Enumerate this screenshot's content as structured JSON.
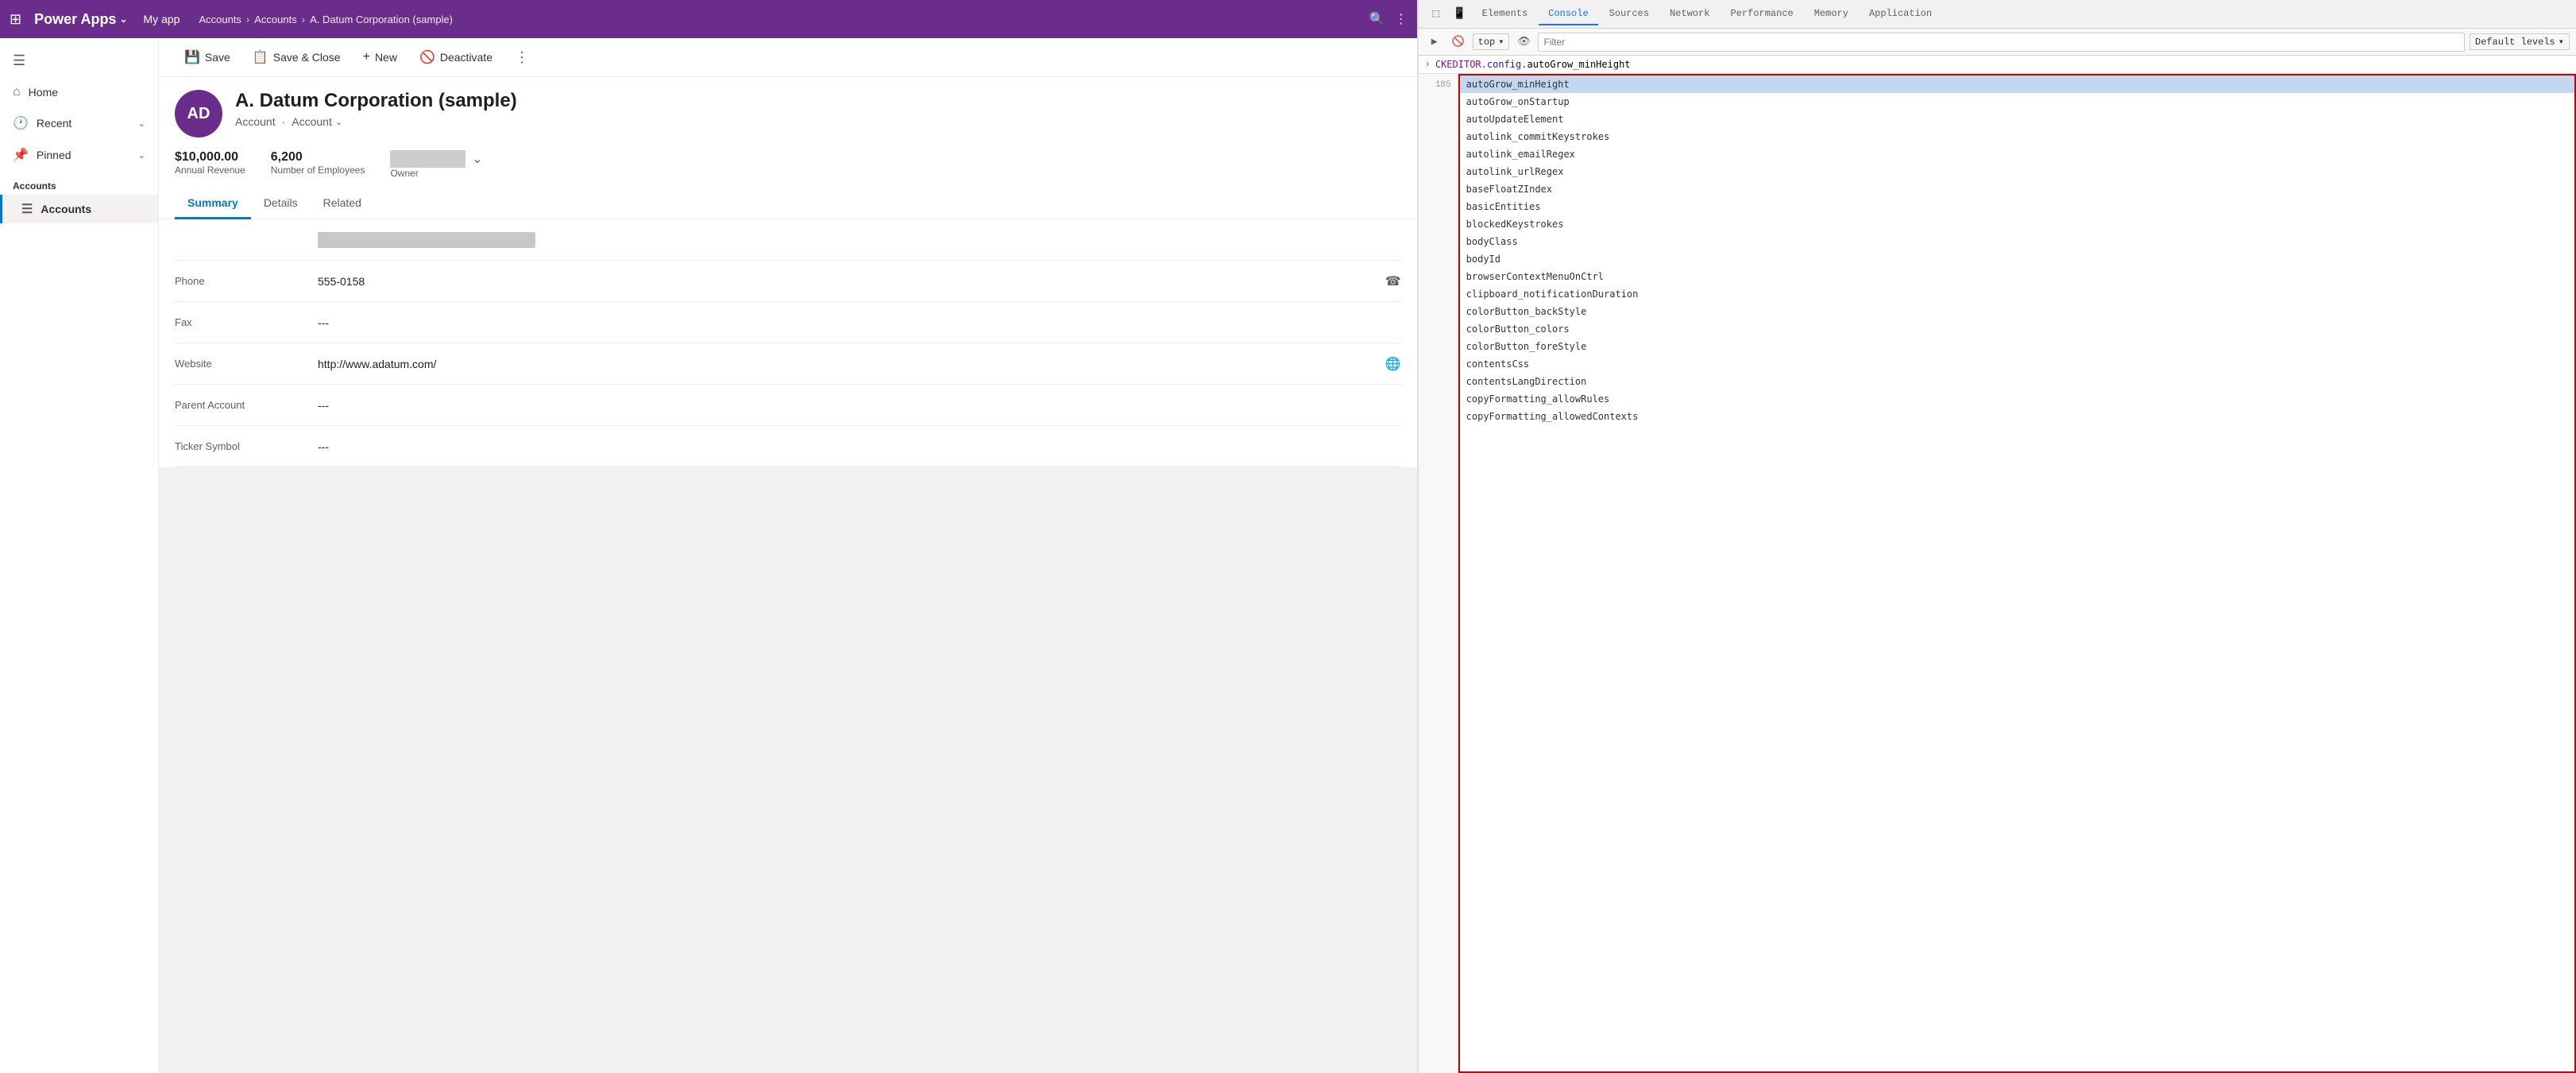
{
  "topNav": {
    "waffleLabel": "⊞",
    "appName": "Power Apps",
    "appChevron": "⌄",
    "myApp": "My app",
    "breadcrumb": [
      "Accounts",
      "Accounts",
      "A. Datum Corporation (sample)"
    ],
    "breadcrumbSeps": [
      ">",
      ">"
    ],
    "searchIcon": "🔍",
    "moreIcon": "⋮"
  },
  "sidebar": {
    "toggleIcon": "☰",
    "navItems": [
      {
        "icon": "⌂",
        "label": "Home"
      },
      {
        "icon": "🕐",
        "label": "Recent",
        "chevron": "⌄"
      },
      {
        "icon": "📌",
        "label": "Pinned",
        "chevron": "⌄"
      }
    ],
    "sectionHeader": "Accounts",
    "subItems": [
      {
        "icon": "☰",
        "label": "Accounts",
        "active": true
      }
    ]
  },
  "toolbar": {
    "saveLabel": "Save",
    "saveCloseLabel": "Save & Close",
    "newLabel": "New",
    "deactivateLabel": "Deactivate",
    "moreIcon": "⋮"
  },
  "record": {
    "initials": "AD",
    "name": "A. Datum Corporation (sample)",
    "typeLabel": "Account",
    "typeSep": "·",
    "typeDropdown": "Account",
    "typeChevron": "⌄",
    "annualRevenue": "$10,000.00",
    "annualRevenueLabel": "Annual Revenue",
    "numEmployees": "6,200",
    "numEmployeesLabel": "Number of Employees",
    "ownerLabel": "Owner",
    "ownerChevron": "⌄"
  },
  "tabs": [
    {
      "label": "Summary",
      "active": true
    },
    {
      "label": "Details",
      "active": false
    },
    {
      "label": "Related",
      "active": false
    }
  ],
  "formFields": [
    {
      "label": "",
      "value": "A. Datum Corporation (sample)",
      "blurred": true,
      "icon": ""
    },
    {
      "label": "Phone",
      "value": "555-0158",
      "icon": "☎"
    },
    {
      "label": "Fax",
      "value": "---",
      "icon": ""
    },
    {
      "label": "Website",
      "value": "http://www.adatum.com/",
      "icon": "🌐"
    },
    {
      "label": "Parent Account",
      "value": "---",
      "icon": ""
    },
    {
      "label": "Ticker Symbol",
      "value": "---",
      "icon": ""
    }
  ],
  "devtools": {
    "tabs": [
      {
        "label": "Elements",
        "icon": ""
      },
      {
        "label": "Console",
        "icon": "",
        "active": true
      },
      {
        "label": "Sources",
        "icon": ""
      },
      {
        "label": "Network",
        "icon": ""
      },
      {
        "label": "Performance",
        "icon": ""
      },
      {
        "label": "Memory",
        "icon": ""
      },
      {
        "label": "Application",
        "icon": ""
      }
    ],
    "toolbar": {
      "runIcon": "▶",
      "blockIcon": "🚫",
      "topSelector": "top",
      "topChevron": "▾",
      "eyeIcon": "👁",
      "filterPlaceholder": "Filter",
      "levelsLabel": "Default levels",
      "levelsChevron": "▾"
    },
    "consoleInput": "CKEDITOR.config.autoGrow_minHeight",
    "consoleKeyword": "CKEDITOR",
    "consoleProperty": "config",
    "consoleHighlight": "autoGrow_minHeight",
    "lineNumber": "185",
    "selectedItem": "autoGrow_minHeight",
    "autocompleteItems": [
      "autoGrow_minHeight",
      "autoGrow_onStartup",
      "autoUpdateElement",
      "autolink_commitKeystrokes",
      "autolink_emailRegex",
      "autolink_urlRegex",
      "baseFloatZIndex",
      "basicEntities",
      "blockedKeystrokes",
      "bodyClass",
      "bodyId",
      "browserContextMenuOnCtrl",
      "clipboard_notificationDuration",
      "colorButton_backStyle",
      "colorButton_colors",
      "colorButton_foreStyle",
      "contentsCss",
      "contentsLangDirection",
      "copyFormatting_allowRules",
      "copyFormatting_allowedContexts"
    ]
  }
}
